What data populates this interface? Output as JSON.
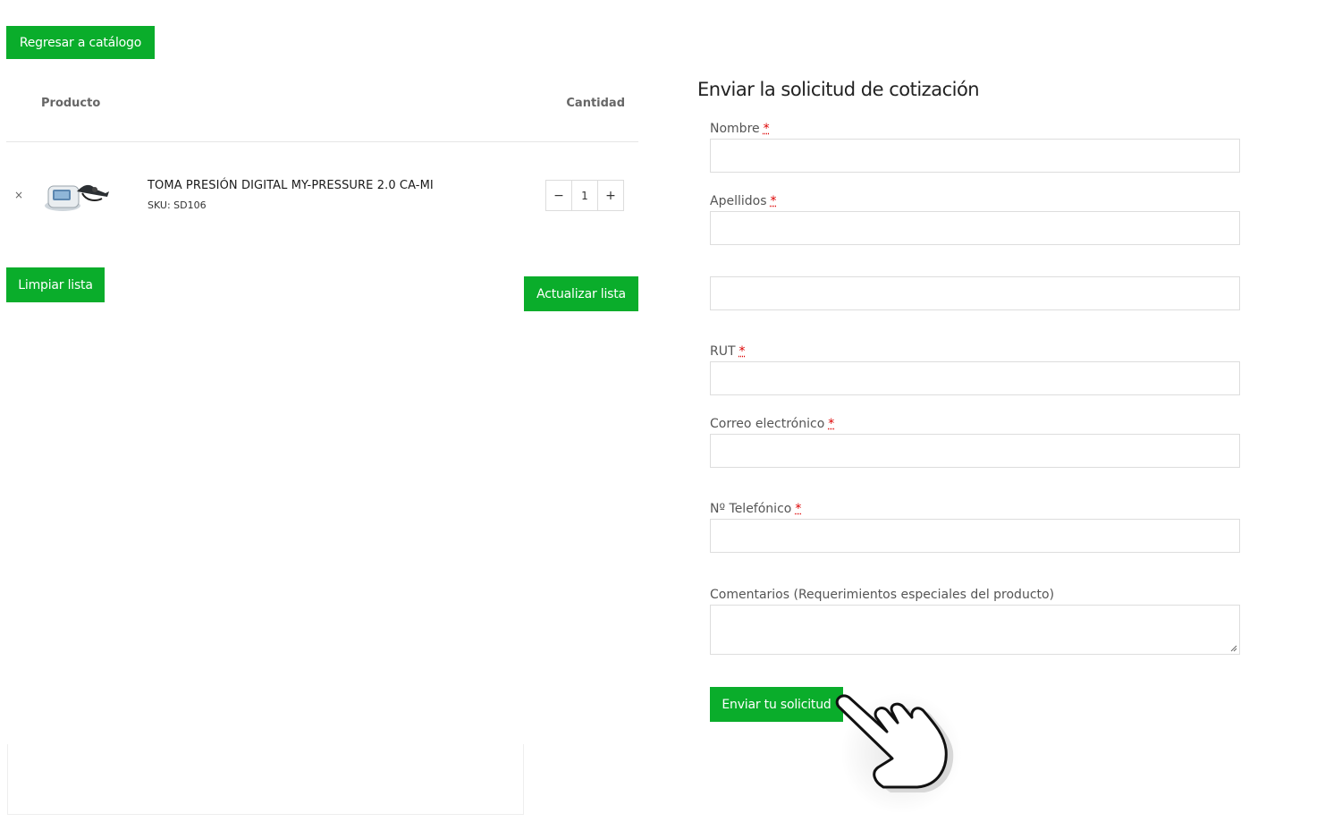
{
  "cart": {
    "back_button": "Regresar a catálogo",
    "columns": {
      "product": "Producto",
      "quantity": "Cantidad"
    },
    "items": [
      {
        "remove": "×",
        "name": "TOMA PRESIÓN DIGITAL MY-PRESSURE 2.0 CA-MI",
        "sku": "SKU: SD106",
        "quantity": "1",
        "decrement": "−",
        "increment": "+"
      }
    ],
    "clear_button": "Limpiar lista",
    "update_button": "Actualizar lista"
  },
  "form": {
    "title": "Enviar la solicitud de cotización",
    "required_mark": "*",
    "fields": {
      "nombre": {
        "label": "Nombre",
        "value": ""
      },
      "apellidos": {
        "label": "Apellidos",
        "value": ""
      },
      "unlabeled": {
        "label": "",
        "value": ""
      },
      "rut": {
        "label": "RUT",
        "value": ""
      },
      "email": {
        "label": "Correo electrónico",
        "value": ""
      },
      "phone": {
        "label": "Nº Telefónico",
        "value": ""
      },
      "comments": {
        "label": "Comentarios (Requerimientos especiales del producto)",
        "value": ""
      }
    },
    "submit_button": "Enviar tu solicitud"
  },
  "colors": {
    "accent": "#0aad2b",
    "required": "#dd0000"
  },
  "icons": {
    "cursor": "hand-pointer-icon",
    "product_image": "blood-pressure-monitor-icon"
  }
}
